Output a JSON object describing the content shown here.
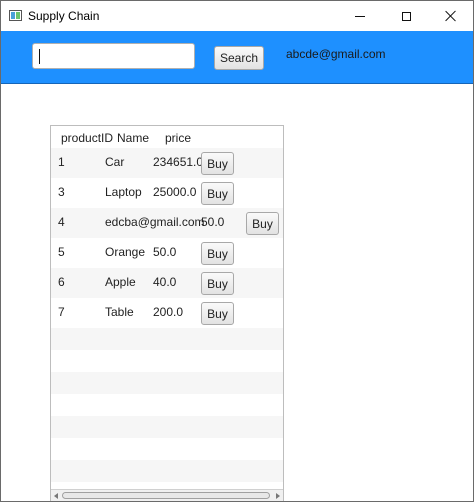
{
  "window": {
    "title": "Supply Chain"
  },
  "topbar": {
    "search_placeholder": "",
    "search_value": "",
    "search_label": "Search",
    "user_email": "abcde@gmail.com"
  },
  "table": {
    "columns": [
      "productID",
      "Name",
      "price"
    ],
    "buy_label": "Buy",
    "rows": [
      {
        "id": "1",
        "name": "Car",
        "price": "234651.0"
      },
      {
        "id": "3",
        "name": "Laptop",
        "price": "25000.0"
      },
      {
        "id": "4",
        "name": "edcba@gmail.com",
        "price": "50.0"
      },
      {
        "id": "5",
        "name": "Orange",
        "price": "50.0"
      },
      {
        "id": "6",
        "name": "Apple",
        "price": "40.0"
      },
      {
        "id": "7",
        "name": "Table",
        "price": "200.0"
      }
    ]
  },
  "colors": {
    "accent": "#1e90ff",
    "row_alt": "#f6f6f6"
  },
  "icons": {
    "app": "app-window-icon",
    "minimize": "minimize-icon",
    "maximize": "maximize-icon",
    "close": "close-icon"
  }
}
